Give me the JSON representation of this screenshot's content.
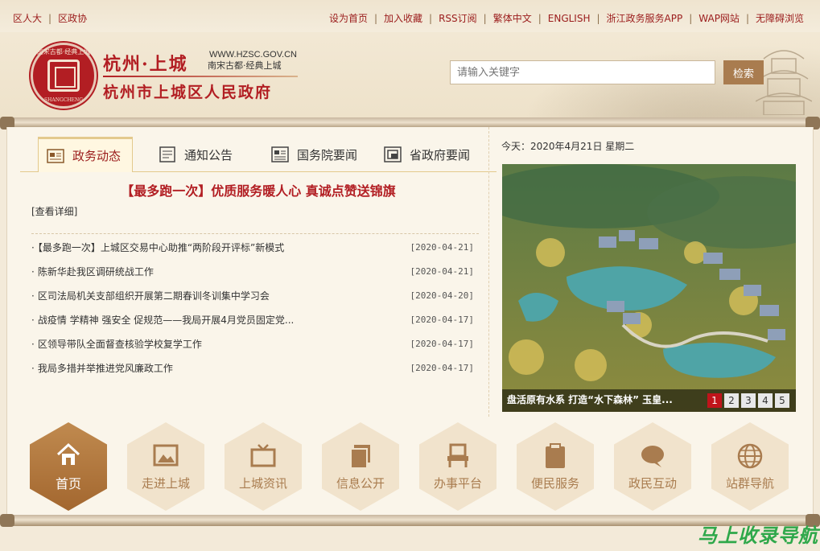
{
  "topbar": {
    "left": [
      "区人大",
      "区政协"
    ],
    "right": [
      "设为首页",
      "加入收藏",
      "RSS订阅",
      "繁体中文",
      "ENGLISH",
      "浙江政务服务APP",
      "WAP网站",
      "无障碍浏览"
    ]
  },
  "header": {
    "brand_top": "杭州·上城",
    "url": "WWW.HZSC.GOV.CN",
    "slogan": "南宋古都·经典上城",
    "brand_bottom": "杭州市上城区人民政府",
    "seal_top": "南宋古都·经典上城",
    "seal_bottom": "SHANGCHENG"
  },
  "search": {
    "placeholder": "请输入关键字",
    "button": "检索"
  },
  "tabs": [
    {
      "label": "政务动态",
      "icon": "newspaper-icon",
      "active": true
    },
    {
      "label": "通知公告",
      "icon": "document-icon",
      "active": false
    },
    {
      "label": "国务院要闻",
      "icon": "news-icon",
      "active": false
    },
    {
      "label": "省政府要闻",
      "icon": "window-icon",
      "active": false
    }
  ],
  "headline": "【最多跑一次】优质服务暖人心 真诚点赞送锦旗",
  "detail_link": "[查看详细]",
  "news": [
    {
      "title": "【最多跑一次】上城区交易中心助推“两阶段开评标”新模式",
      "date": "[2020-04-21]"
    },
    {
      "title": "陈新华赴我区调研统战工作",
      "date": "[2020-04-21]"
    },
    {
      "title": "区司法局机关支部组织开展第二期春训冬训集中学习会",
      "date": "[2020-04-20]"
    },
    {
      "title": "战疫情 学精神 强安全 促规范——我局开展4月党员固定党...",
      "date": "[2020-04-17]"
    },
    {
      "title": "区领导带队全面督查核验学校复学工作",
      "date": "[2020-04-17]"
    },
    {
      "title": "我局多措并举推进党风廉政工作",
      "date": "[2020-04-17]"
    }
  ],
  "today": "今天：2020年4月21日  星期二",
  "slider": {
    "caption": "盘活原有水系 打造“水下森林” 玉皇...",
    "pages": [
      "1",
      "2",
      "3",
      "4",
      "5"
    ],
    "current": 1
  },
  "hexnav": [
    {
      "label": "首页",
      "icon": "home-icon",
      "active": true
    },
    {
      "label": "走进上城",
      "icon": "picture-icon",
      "active": false
    },
    {
      "label": "上城资讯",
      "icon": "tv-icon",
      "active": false
    },
    {
      "label": "信息公开",
      "icon": "files-icon",
      "active": false
    },
    {
      "label": "办事平台",
      "icon": "chair-icon",
      "active": false
    },
    {
      "label": "便民服务",
      "icon": "clipboard-icon",
      "active": false
    },
    {
      "label": "政民互动",
      "icon": "chat-icon",
      "active": false
    },
    {
      "label": "站群导航",
      "icon": "globe-icon",
      "active": false
    }
  ],
  "watermark": "马上收录导航",
  "colors": {
    "red": "#b21e23",
    "gold": "#a97c4f",
    "bg": "#faf5ea"
  }
}
